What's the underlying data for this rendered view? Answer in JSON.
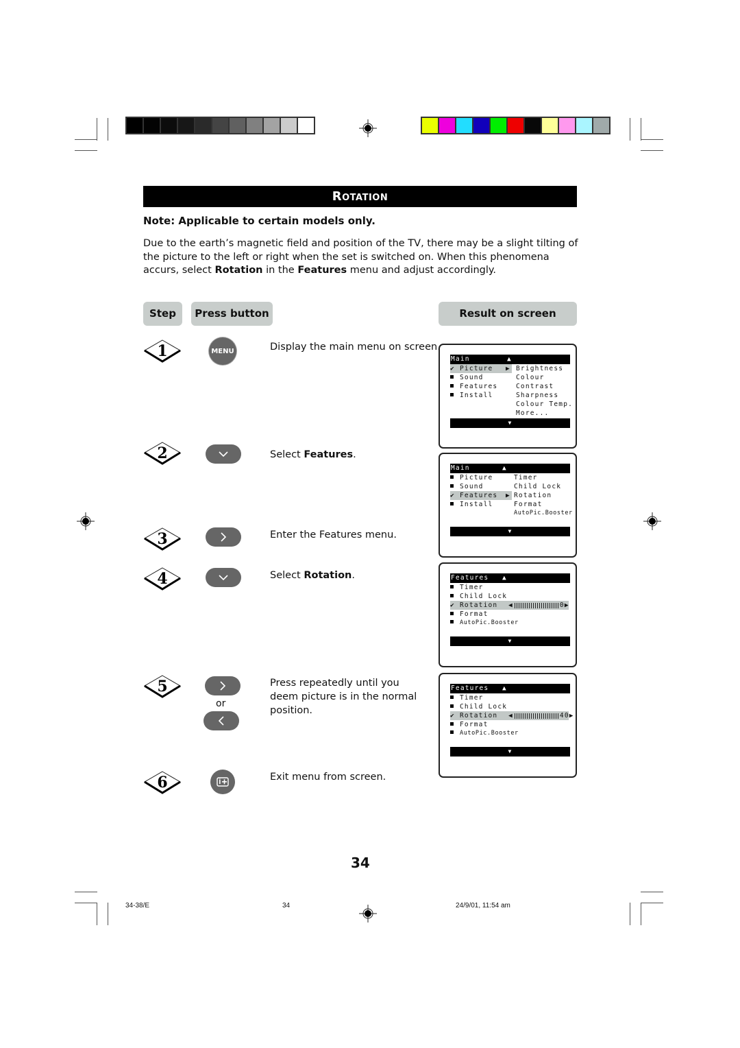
{
  "section_title": "Rotation",
  "note": "Note: Applicable to certain models only.",
  "intro": {
    "part1": "Due to the earth’s magnetic field and position of the TV, there may be a slight tilting of the picture to the left or right when the set is switched on. When this phenomena accurs, select ",
    "bold1": "Rotation",
    "part2": " in the ",
    "bold2": "Features",
    "part3": " menu and adjust accordingly."
  },
  "headers": {
    "step": "Step",
    "press": "Press button",
    "result": "Result on screen"
  },
  "color_bars": {
    "grayscale": [
      "#000000",
      "#030303",
      "#0c0c0c",
      "#171717",
      "#2a2a2a",
      "#444444",
      "#606060",
      "#808080",
      "#a3a3a3",
      "#cccccc",
      "#ffffff"
    ],
    "colors": [
      "#eaff00",
      "#ee00dd",
      "#22ddff",
      "#1100bb",
      "#00ee00",
      "#ee0000",
      "#080808",
      "#ffff99",
      "#ff99ee",
      "#aaf5ff",
      "#a0aaaa"
    ]
  },
  "steps": [
    {
      "num": "1",
      "button": "MENU",
      "button_icon": "menu-button-icon",
      "text": "Display the main menu on screen.",
      "bold": ""
    },
    {
      "num": "2",
      "button": "⌄",
      "button_icon": "cursor-down-icon",
      "text": "Select ",
      "bold": "Features",
      "suffix": "."
    },
    {
      "num": "3",
      "button": "›",
      "button_icon": "cursor-right-icon",
      "text": "Enter the Features menu.",
      "bold": ""
    },
    {
      "num": "4",
      "button": "⌄",
      "button_icon": "cursor-down-icon",
      "text": "Select ",
      "bold": "Rotation",
      "suffix": "."
    },
    {
      "num": "5",
      "button": "›",
      "button_alt": "‹",
      "or": "or",
      "button_icon": "cursor-right-icon",
      "text": "Press repeatedly until you deem picture is in the normal position.",
      "bold": ""
    },
    {
      "num": "6",
      "button": "i+",
      "button_icon": "osd-info-icon",
      "text": "Exit menu from screen.",
      "bold": ""
    }
  ],
  "screens": [
    {
      "title": "Main",
      "up": "▲",
      "down": "▼",
      "left": [
        {
          "mark": "✔",
          "label": "Picture",
          "selected": true
        },
        {
          "mark": "■",
          "label": "Sound"
        },
        {
          "mark": "■",
          "label": "Features"
        },
        {
          "mark": "■",
          "label": "Install"
        }
      ],
      "arrow": "▶",
      "right": [
        "Brightness",
        "Colour",
        "Contrast",
        "Sharpness",
        "Colour Temp.",
        "More..."
      ]
    },
    {
      "title": "Main",
      "up": "▲",
      "down": "▼",
      "left": [
        {
          "mark": "■",
          "label": "Picture"
        },
        {
          "mark": "■",
          "label": "Sound"
        },
        {
          "mark": "✔",
          "label": "Features",
          "selected": true
        },
        {
          "mark": "■",
          "label": "Install"
        }
      ],
      "arrow": "▶",
      "right": [
        "Timer",
        "Child Lock",
        "Rotation",
        "Format",
        "AutoPic.Booster"
      ]
    },
    {
      "title": "Features",
      "up": "▲",
      "down": "▼",
      "items": [
        {
          "mark": "■",
          "label": "Timer"
        },
        {
          "mark": "■",
          "label": "Child Lock"
        },
        {
          "mark": "✔",
          "label": "Rotation",
          "selected": true,
          "value": "0"
        },
        {
          "mark": "■",
          "label": "Format"
        },
        {
          "mark": "■",
          "label": "AutoPic.Booster"
        }
      ]
    },
    {
      "title": "Features",
      "up": "▲",
      "down": "▼",
      "items": [
        {
          "mark": "■",
          "label": "Timer"
        },
        {
          "mark": "■",
          "label": "Child Lock"
        },
        {
          "mark": "✔",
          "label": "Rotation",
          "selected": true,
          "value": "40"
        },
        {
          "mark": "■",
          "label": "Format"
        },
        {
          "mark": "■",
          "label": "AutoPic.Booster"
        }
      ]
    }
  ],
  "page_number": "34",
  "footer": {
    "code": "34-38/E",
    "page": "34",
    "timestamp": "24/9/01, 11:54 am"
  }
}
